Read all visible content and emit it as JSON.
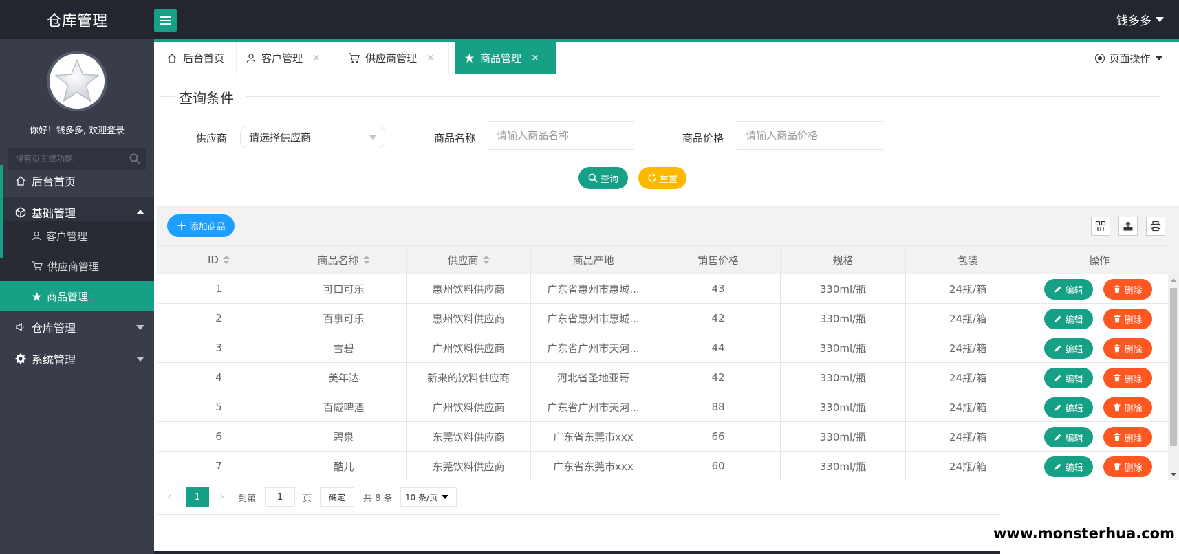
{
  "app": {
    "title": "仓库管理",
    "user": "钱多多",
    "accent": "#16a085"
  },
  "sidebar": {
    "welcome": "你好！钱多多, 欢迎登录",
    "search_placeholder": "搜索页面或功能",
    "home": "后台首页",
    "basic": "基础管理",
    "sub": [
      "客户管理",
      "供应商管理",
      "商品管理"
    ],
    "warehouse": "仓库管理",
    "system": "系统管理"
  },
  "tabs": {
    "items": [
      "后台首页",
      "客户管理",
      "供应商管理",
      "商品管理"
    ],
    "close": "✕",
    "page_ops": "页面操作"
  },
  "query": {
    "title": "查询条件",
    "supplier_label": "供应商",
    "supplier_value": "请选择供应商",
    "name_label": "商品名称",
    "name_placeholder": "请输入商品名称",
    "price_label": "商品价格",
    "price_placeholder": "请输入商品价格",
    "search_btn": "查询",
    "reset_btn": "重置"
  },
  "toolbar": {
    "add_btn": "添加商品"
  },
  "table": {
    "headers": [
      "ID",
      "商品名称",
      "供应商",
      "商品产地",
      "销售价格",
      "规格",
      "包装",
      "操作"
    ],
    "edit_label": "编辑",
    "delete_label": "删除",
    "rows": [
      {
        "id": "1",
        "name": "可口可乐",
        "supplier": "惠州饮料供应商",
        "origin": "广东省惠州市惠城...",
        "price": "43",
        "spec": "330ml/瓶",
        "pack": "24瓶/箱"
      },
      {
        "id": "2",
        "name": "百事可乐",
        "supplier": "惠州饮料供应商",
        "origin": "广东省惠州市惠城...",
        "price": "42",
        "spec": "330ml/瓶",
        "pack": "24瓶/箱"
      },
      {
        "id": "3",
        "name": "雪碧",
        "supplier": "广州饮料供应商",
        "origin": "广东省广州市天河...",
        "price": "44",
        "spec": "330ml/瓶",
        "pack": "24瓶/箱"
      },
      {
        "id": "4",
        "name": "美年达",
        "supplier": "新来的饮料供应商",
        "origin": "河北省圣地亚哥",
        "price": "42",
        "spec": "330ml/瓶",
        "pack": "24瓶/箱"
      },
      {
        "id": "5",
        "name": "百威啤酒",
        "supplier": "广州饮料供应商",
        "origin": "广东省广州市天河...",
        "price": "88",
        "spec": "330ml/瓶",
        "pack": "24瓶/箱"
      },
      {
        "id": "6",
        "name": "碧泉",
        "supplier": "东莞饮料供应商",
        "origin": "广东省东莞市xxx",
        "price": "66",
        "spec": "330ml/瓶",
        "pack": "24瓶/箱"
      },
      {
        "id": "7",
        "name": "酷儿",
        "supplier": "东莞饮料供应商",
        "origin": "广东省东莞市xxx",
        "price": "60",
        "spec": "330ml/瓶",
        "pack": "24瓶/箱"
      }
    ]
  },
  "pager": {
    "current": "1",
    "goto": "到第",
    "goto_value": "1",
    "page_unit": "页",
    "confirm": "确定",
    "total": "共 8 条",
    "size": "10 条/页"
  },
  "watermark": "www.monsterhua.com"
}
